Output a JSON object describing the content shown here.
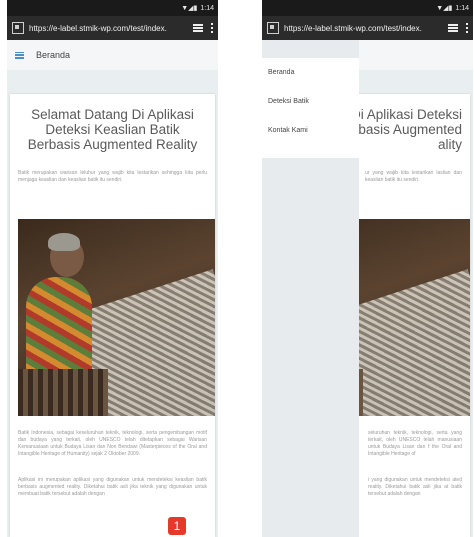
{
  "status": {
    "time": "1:14",
    "signal": "▼◢▮"
  },
  "browser": {
    "url": "https://e-label.stmik-wp.com/test/index."
  },
  "nav": {
    "brand": "Beranda"
  },
  "page": {
    "title": "Selamat Datang Di Aplikasi Deteksi Keaslian Batik Berbasis Augmented Reality",
    "intro": "Batik merupakan warisan leluhur yang wajib kita lestarikan sehingga kita perlu menjaga keaslian dan keaslian batik itu sendiri.",
    "para1": "Batik Indonesia, sebagai keseluruhan teknik, teknologi, serta pengembangan motif dan budaya yang terkait, oleh UNESCO telah ditetapkan sebagai Warisan Kemanusiaan untuk Budaya Lisan dan Non Bendawi (Masterpieces of the Oral and Intangible Heritage of Humanity) sejak 2 Oktober 2009.",
    "para2": "Aplikasi ini merupakan aplikasi yang digunakan untuk mendeteksi keaslian batik berbasis augmented reality. Diketahui batik asli jika teknik yang digunakan untuk membuat batik tersebut adalah dengan"
  },
  "drawer": {
    "items": [
      "Beranda",
      "Deteksi Batik",
      "Kontak Kami"
    ]
  },
  "right_partial": {
    "title": "g Di Aplikasi Deteksi Berbasis Augmented ality",
    "intro": "ur yang wajib kita lestarikan laslian dan keaslian batik itu sendiri.",
    "para1": "seluruhan teknik, teknologi, serta yang terkait, oleh UNESCO telah manusiaan untuk Budaya Lisan dan f the Oral and Intangible Heritage of",
    "para2": "i yang digunakan untuk mendeteksi ated reality. Diketahui batik asli jika at batik tersebut adalah dengan"
  },
  "badge": {
    "label": "1"
  }
}
